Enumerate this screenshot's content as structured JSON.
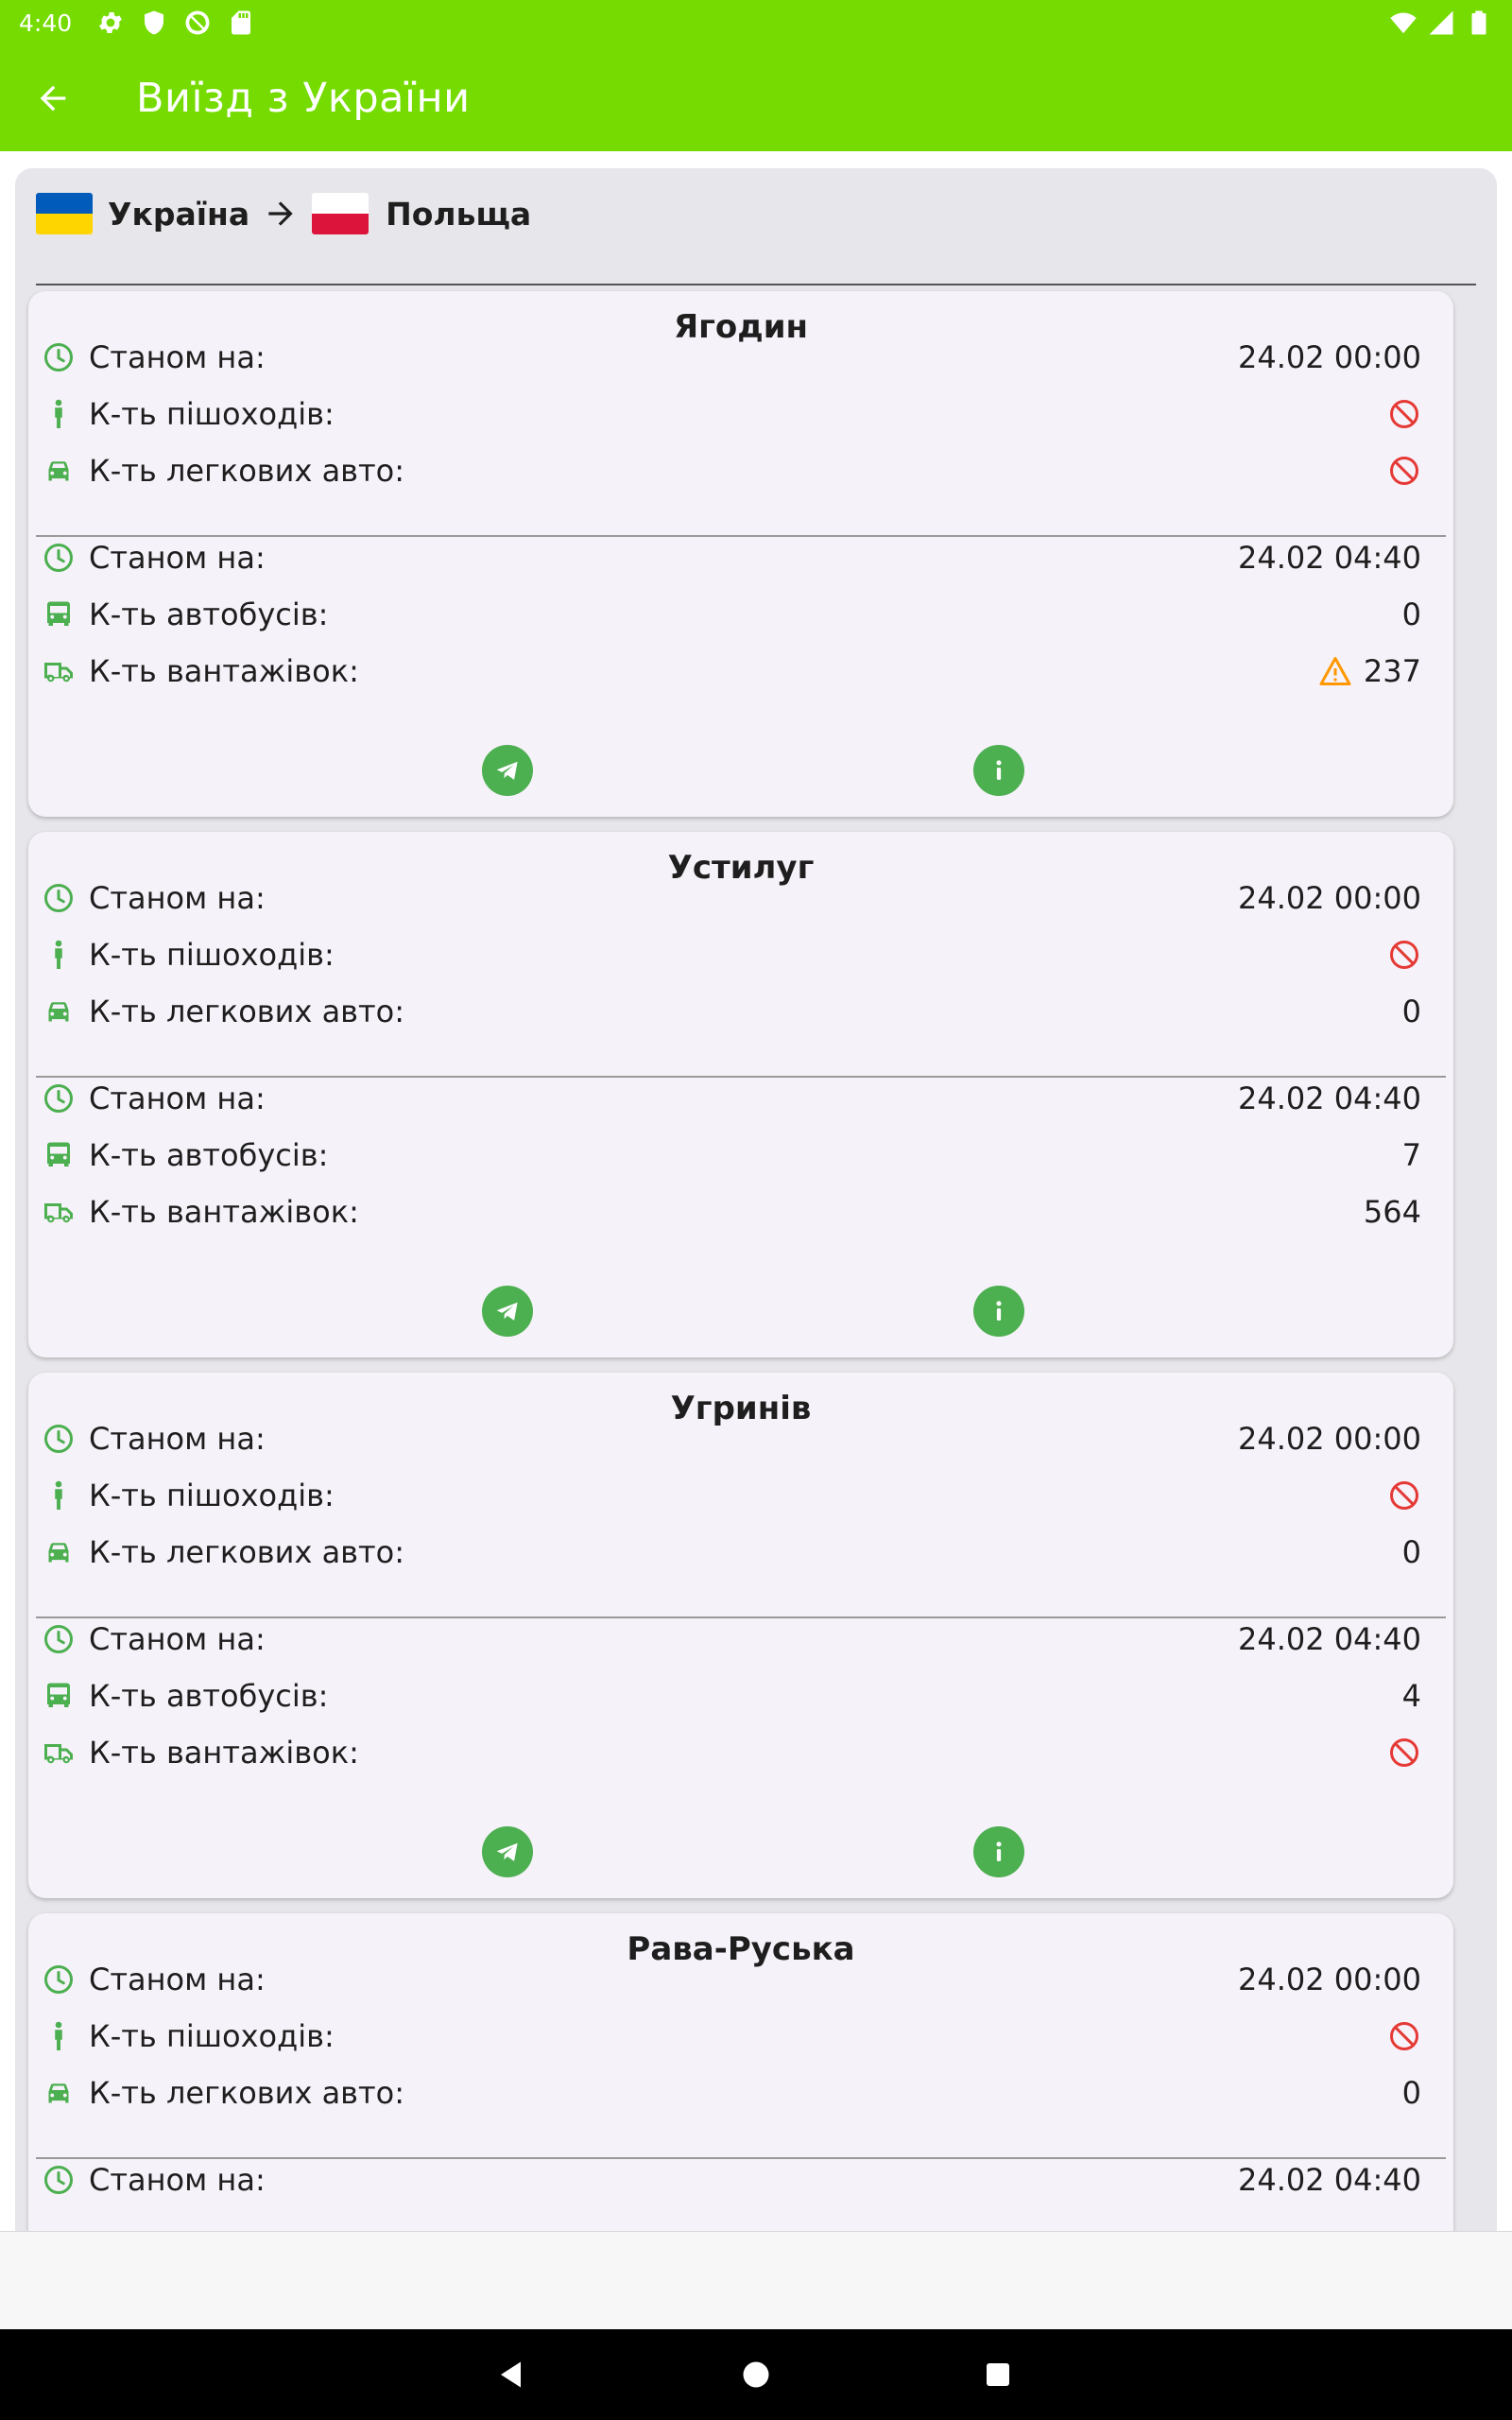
{
  "status_bar": {
    "time": "4:40",
    "icons": [
      "gear-icon",
      "shield-icon",
      "vpn-icon",
      "sd-card-icon"
    ],
    "right_icons": [
      "wifi-icon",
      "signal-icon",
      "battery-icon"
    ]
  },
  "app_bar": {
    "title": "Виїзд з України",
    "back_icon": "arrow-back-icon"
  },
  "route": {
    "from": "Україна",
    "to": "Польща",
    "from_flag_colors": [
      "#005bbb",
      "#ffd500"
    ],
    "to_flag_colors": [
      "#ffffff",
      "#dc143c"
    ]
  },
  "labels": {
    "as_of": "Станом на:",
    "pedestrians": "К-ть пішоходів:",
    "cars": "К-ть легкових авто:",
    "buses": "К-ть автобусів:",
    "trucks": "К-ть вантажівок:"
  },
  "colors": {
    "accent": "#75db00",
    "icon_green": "#4caf50",
    "blocked_red": "#e53935",
    "warning_orange": "#ff9800"
  },
  "checkpoints": [
    {
      "name": "Ягодин",
      "as_of_1": "24.02 00:00",
      "pedestrians": "",
      "pedestrians_status": "blocked",
      "cars": "",
      "cars_status": "blocked",
      "as_of_2": "24.02 04:40",
      "buses": "0",
      "buses_status": "ok",
      "trucks": "237",
      "trucks_status": "warning"
    },
    {
      "name": "Устилуг",
      "as_of_1": "24.02 00:00",
      "pedestrians": "",
      "pedestrians_status": "blocked",
      "cars": "0",
      "cars_status": "ok",
      "as_of_2": "24.02 04:40",
      "buses": "7",
      "buses_status": "ok",
      "trucks": "564",
      "trucks_status": "ok"
    },
    {
      "name": "Угринів",
      "as_of_1": "24.02 00:00",
      "pedestrians": "",
      "pedestrians_status": "blocked",
      "cars": "0",
      "cars_status": "ok",
      "as_of_2": "24.02 04:40",
      "buses": "4",
      "buses_status": "ok",
      "trucks": "",
      "trucks_status": "blocked"
    },
    {
      "name": "Рава-Руська",
      "as_of_1": "24.02 00:00",
      "pedestrians": "",
      "pedestrians_status": "blocked",
      "cars": "0",
      "cars_status": "ok",
      "as_of_2": "24.02 04:40"
    }
  ],
  "nav_bar": [
    "back-triangle-icon",
    "home-circle-icon",
    "recents-square-icon"
  ]
}
